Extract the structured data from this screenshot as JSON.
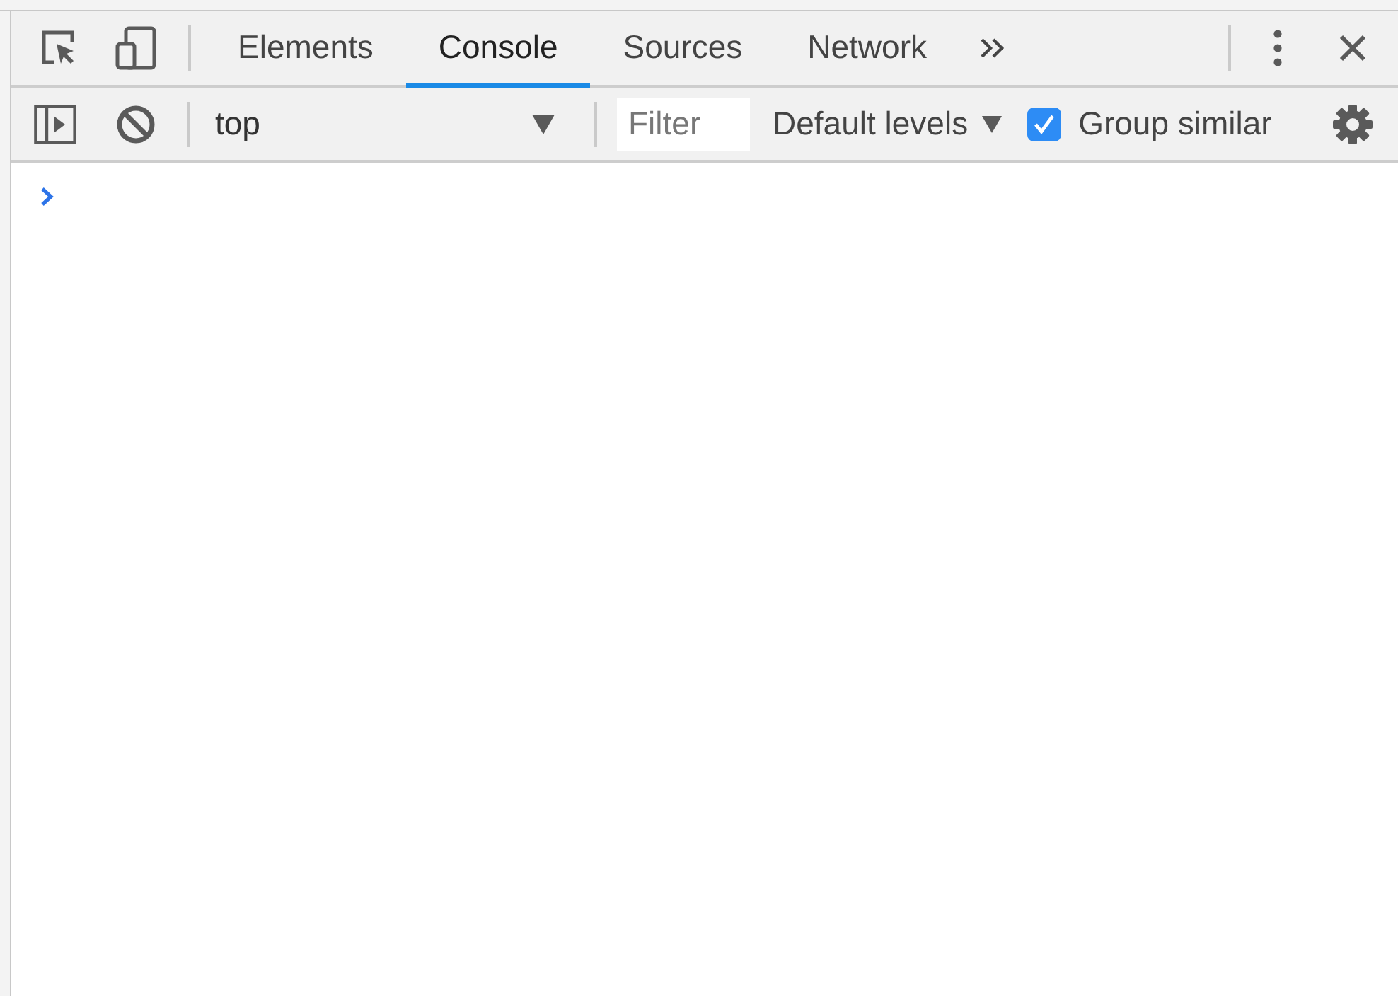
{
  "tabs": [
    {
      "label": "Elements",
      "selected": false
    },
    {
      "label": "Console",
      "selected": true
    },
    {
      "label": "Sources",
      "selected": false
    },
    {
      "label": "Network",
      "selected": false
    }
  ],
  "console_toolbar": {
    "context": "top",
    "filter": {
      "placeholder": "Filter"
    },
    "levels": "Default levels",
    "group_similar": {
      "label": "Group similar",
      "checked": true
    }
  }
}
